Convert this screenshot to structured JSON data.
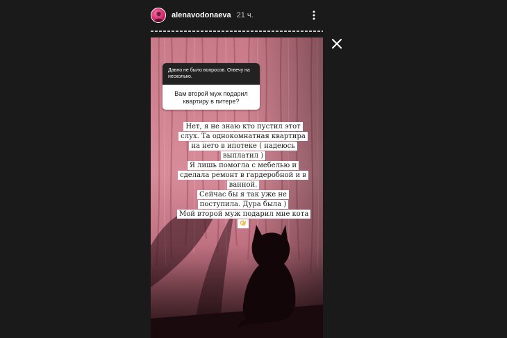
{
  "header": {
    "username": "alenavodonaeva",
    "time": "21 ч."
  },
  "question": {
    "header": "Давно не было вопросов. Отвечу на несколько.",
    "text": "Вам второй муж подарил квартиру в питере?"
  },
  "answer": {
    "lines": [
      "Нет, я не знаю кто пустил этот слух. Та однокомнатная квартира на него в ипотеке ( надеюсь выплатил )",
      "Я лишь помогла с мебелью и сделала ремонт в гардеробной и в  ванной.",
      "Сейчас бы я так уже не поступила. Дура была )",
      "Мой второй муж подарил мне кота"
    ],
    "emoji": "ok-hand-icon"
  },
  "icons": {
    "avatar": "avatar",
    "more": "more-vertical-icon",
    "close": "close-icon"
  },
  "colors": {
    "background": "#1a1a1a",
    "curtain": "#d98a9a",
    "avatar_ring": "#e91e63"
  }
}
